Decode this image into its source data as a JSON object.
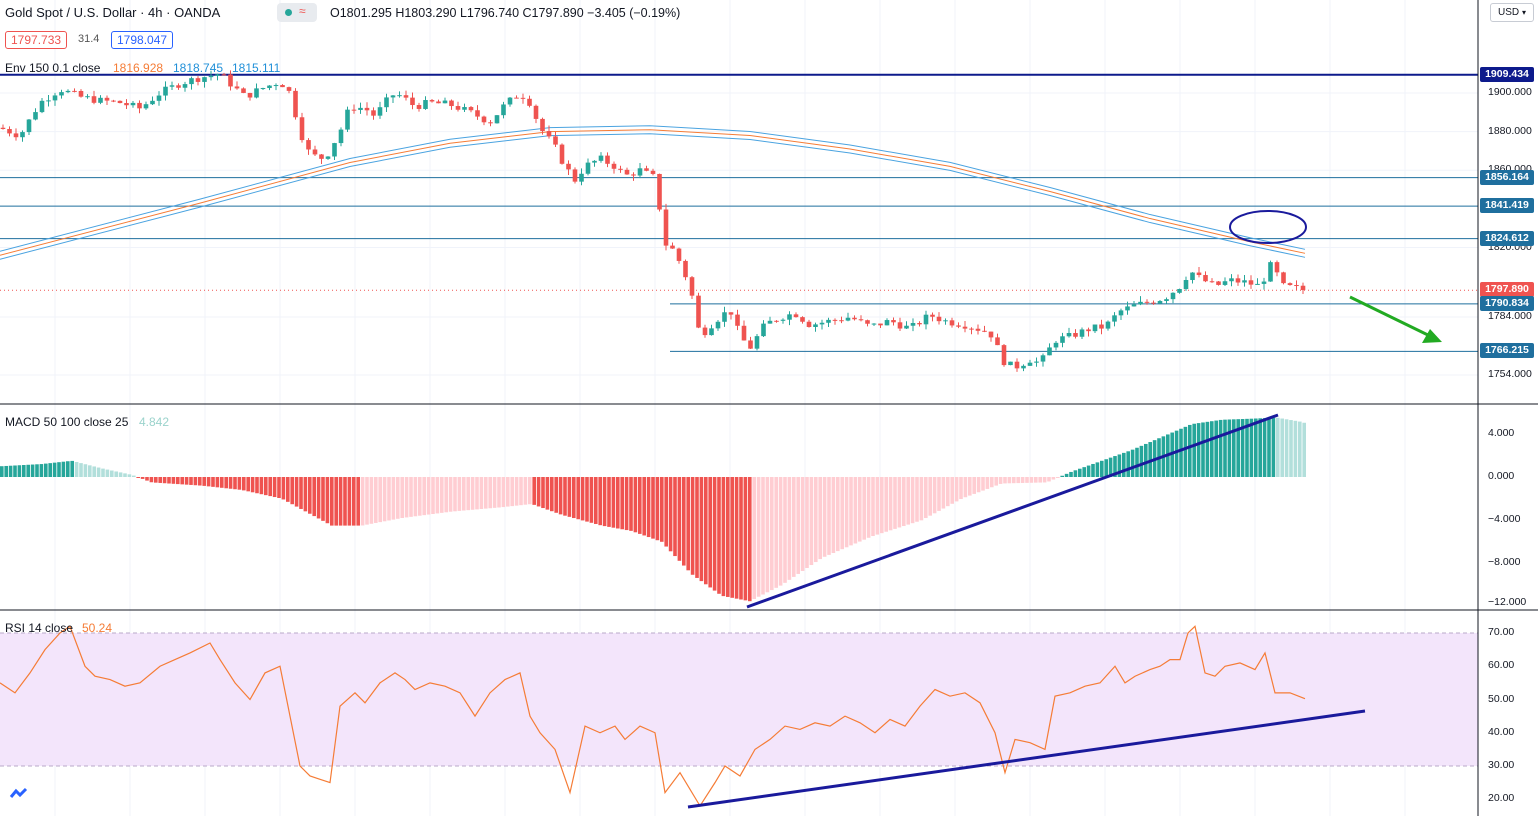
{
  "header": {
    "symbol": "Gold Spot / U.S. Dollar · 4h · OANDA",
    "ohlc": "O1801.295 H1803.290 L1796.740 C1797.890 −3.405 (−0.19%)",
    "sell_price": "1797.733",
    "spread": "31.4",
    "buy_price": "1798.047",
    "currency_button": "USD"
  },
  "indicators": {
    "env": {
      "label": "Env 150 0.1 close",
      "v1": "1816.928",
      "v2": "1818.745",
      "v3": "1815.111"
    },
    "macd": {
      "label": "MACD 50 100 close 25",
      "value": "4.842"
    },
    "rsi": {
      "label": "RSI 14 close",
      "value": "50.24"
    }
  },
  "price_axis": {
    "ticks": [
      "1900.000",
      "1880.000",
      "1860.000",
      "1820.000",
      "1784.000",
      "1754.000"
    ],
    "labels": [
      {
        "text": "1909.434",
        "color": "#0d1a8c"
      },
      {
        "text": "1856.164",
        "color": "#1f6f9e"
      },
      {
        "text": "1841.419",
        "color": "#1f6f9e"
      },
      {
        "text": "1824.612",
        "color": "#1f6f9e"
      },
      {
        "text": "1797.890",
        "color": "#ef5350"
      },
      {
        "text": "1790.834",
        "color": "#1f6f9e"
      },
      {
        "text": "1766.215",
        "color": "#1f6f9e"
      }
    ]
  },
  "macd_axis": {
    "ticks": [
      "4.000",
      "0.000",
      "−4.000",
      "−8.000",
      "−12.000"
    ]
  },
  "rsi_axis": {
    "ticks": [
      "70.00",
      "60.00",
      "50.00",
      "40.00",
      "30.00",
      "20.00"
    ]
  },
  "colors": {
    "bull": "#26a69a",
    "bear": "#ef5350",
    "hist_pos_strong": "#26a69a",
    "hist_pos_weak": "#b2dfdb",
    "hist_neg_strong": "#ef5350",
    "hist_neg_weak": "#ffcdd2",
    "rsi_line": "#f57c36",
    "rsi_band": "#f3e5fb",
    "support_line": "#1f6f9e",
    "top_line": "#0d1a8c",
    "trend_line": "#1a1a9c",
    "arrow": "#22aa22"
  },
  "chart_data": {
    "type": "candlestick",
    "timeframe": "4h",
    "levels": [
      1909.434,
      1856.164,
      1841.419,
      1824.612,
      1790.834,
      1766.215
    ],
    "last_price": 1797.89,
    "ohlc_last": {
      "open": 1801.295,
      "high": 1803.29,
      "low": 1796.74,
      "close": 1797.89
    },
    "close_path": [
      [
        0,
        1882
      ],
      [
        20,
        1878
      ],
      [
        40,
        1895
      ],
      [
        60,
        1902
      ],
      [
        80,
        1898
      ],
      [
        100,
        1896
      ],
      [
        120,
        1895
      ],
      [
        140,
        1892
      ],
      [
        160,
        1900
      ],
      [
        180,
        1905
      ],
      [
        200,
        1908
      ],
      [
        220,
        1910
      ],
      [
        230,
        1905
      ],
      [
        245,
        1898
      ],
      [
        260,
        1902
      ],
      [
        280,
        1906
      ],
      [
        290,
        1900
      ],
      [
        300,
        1880
      ],
      [
        310,
        1868
      ],
      [
        325,
        1866
      ],
      [
        340,
        1880
      ],
      [
        350,
        1893
      ],
      [
        365,
        1892
      ],
      [
        375,
        1888
      ],
      [
        385,
        1895
      ],
      [
        395,
        1900
      ],
      [
        405,
        1897
      ],
      [
        415,
        1893
      ],
      [
        430,
        1895
      ],
      [
        450,
        1894
      ],
      [
        470,
        1890
      ],
      [
        490,
        1885
      ],
      [
        505,
        1894
      ],
      [
        520,
        1900
      ],
      [
        530,
        1895
      ],
      [
        540,
        1882
      ],
      [
        555,
        1872
      ],
      [
        565,
        1862
      ],
      [
        575,
        1855
      ],
      [
        585,
        1862
      ],
      [
        600,
        1866
      ],
      [
        615,
        1862
      ],
      [
        625,
        1857
      ],
      [
        640,
        1860
      ],
      [
        655,
        1856
      ],
      [
        665,
        1822
      ],
      [
        675,
        1818
      ],
      [
        690,
        1800
      ],
      [
        700,
        1774
      ],
      [
        715,
        1782
      ],
      [
        730,
        1788
      ],
      [
        740,
        1774
      ],
      [
        750,
        1768
      ],
      [
        765,
        1780
      ],
      [
        780,
        1784
      ],
      [
        795,
        1786
      ],
      [
        810,
        1780
      ],
      [
        830,
        1782
      ],
      [
        850,
        1784
      ],
      [
        870,
        1779
      ],
      [
        890,
        1782
      ],
      [
        910,
        1778
      ],
      [
        930,
        1785
      ],
      [
        945,
        1782
      ],
      [
        965,
        1780
      ],
      [
        990,
        1776
      ],
      [
        1005,
        1760
      ],
      [
        1015,
        1758
      ],
      [
        1030,
        1762
      ],
      [
        1040,
        1760
      ],
      [
        1055,
        1772
      ],
      [
        1070,
        1774
      ],
      [
        1090,
        1778
      ],
      [
        1105,
        1779
      ],
      [
        1120,
        1787
      ],
      [
        1135,
        1790
      ],
      [
        1150,
        1792
      ],
      [
        1165,
        1794
      ],
      [
        1180,
        1800
      ],
      [
        1190,
        1808
      ],
      [
        1200,
        1804
      ],
      [
        1215,
        1800
      ],
      [
        1230,
        1803
      ],
      [
        1245,
        1802
      ],
      [
        1260,
        1800
      ],
      [
        1272,
        1812
      ],
      [
        1282,
        1800
      ],
      [
        1295,
        1799
      ],
      [
        1305,
        1797.89
      ]
    ],
    "envelope": [
      [
        0,
        1816
      ],
      [
        200,
        1843
      ],
      [
        350,
        1864
      ],
      [
        450,
        1874
      ],
      [
        550,
        1880
      ],
      [
        650,
        1881
      ],
      [
        750,
        1878
      ],
      [
        850,
        1871
      ],
      [
        950,
        1862
      ],
      [
        1050,
        1849
      ],
      [
        1150,
        1835
      ],
      [
        1250,
        1823
      ],
      [
        1305,
        1817
      ]
    ],
    "macd_hist": [
      [
        0,
        1.0
      ],
      [
        40,
        1.2
      ],
      [
        70,
        1.5
      ],
      [
        100,
        0.8
      ],
      [
        130,
        0.2
      ],
      [
        150,
        -0.5
      ],
      [
        200,
        -0.8
      ],
      [
        240,
        -1.2
      ],
      [
        280,
        -2.0
      ],
      [
        310,
        -3.5
      ],
      [
        330,
        -4.5
      ],
      [
        360,
        -4.5
      ],
      [
        400,
        -3.8
      ],
      [
        450,
        -3.2
      ],
      [
        500,
        -2.8
      ],
      [
        530,
        -2.5
      ],
      [
        560,
        -3.5
      ],
      [
        600,
        -4.5
      ],
      [
        630,
        -5.0
      ],
      [
        660,
        -6.0
      ],
      [
        690,
        -9.0
      ],
      [
        720,
        -11.0
      ],
      [
        748,
        -11.5
      ],
      [
        780,
        -10.0
      ],
      [
        820,
        -7.5
      ],
      [
        870,
        -5.5
      ],
      [
        920,
        -4.0
      ],
      [
        960,
        -2.0
      ],
      [
        1000,
        -0.6
      ],
      [
        1045,
        -0.5
      ],
      [
        1070,
        0.5
      ],
      [
        1100,
        1.5
      ],
      [
        1130,
        2.5
      ],
      [
        1160,
        3.7
      ],
      [
        1190,
        4.9
      ],
      [
        1220,
        5.3
      ],
      [
        1250,
        5.4
      ],
      [
        1275,
        5.5
      ],
      [
        1300,
        5.1
      ],
      [
        1308,
        4.842
      ]
    ],
    "rsi": [
      [
        0,
        55
      ],
      [
        15,
        52
      ],
      [
        30,
        58
      ],
      [
        45,
        65
      ],
      [
        60,
        70
      ],
      [
        70,
        72
      ],
      [
        85,
        60
      ],
      [
        95,
        57
      ],
      [
        110,
        56
      ],
      [
        125,
        54
      ],
      [
        140,
        55
      ],
      [
        160,
        60
      ],
      [
        175,
        62
      ],
      [
        190,
        64
      ],
      [
        210,
        67
      ],
      [
        220,
        62
      ],
      [
        235,
        55
      ],
      [
        250,
        50
      ],
      [
        265,
        58
      ],
      [
        280,
        60
      ],
      [
        290,
        45
      ],
      [
        300,
        30
      ],
      [
        310,
        27
      ],
      [
        320,
        26
      ],
      [
        330,
        25
      ],
      [
        340,
        48
      ],
      [
        355,
        52
      ],
      [
        365,
        49
      ],
      [
        380,
        55
      ],
      [
        395,
        58
      ],
      [
        405,
        56
      ],
      [
        415,
        53
      ],
      [
        430,
        55
      ],
      [
        445,
        54
      ],
      [
        460,
        52
      ],
      [
        475,
        45
      ],
      [
        490,
        52
      ],
      [
        505,
        56
      ],
      [
        520,
        58
      ],
      [
        530,
        45
      ],
      [
        540,
        40
      ],
      [
        555,
        35
      ],
      [
        570,
        22
      ],
      [
        585,
        42
      ],
      [
        600,
        40
      ],
      [
        615,
        42
      ],
      [
        625,
        38
      ],
      [
        640,
        42
      ],
      [
        655,
        40
      ],
      [
        665,
        22
      ],
      [
        680,
        28
      ],
      [
        700,
        18
      ],
      [
        715,
        25
      ],
      [
        725,
        30
      ],
      [
        740,
        27
      ],
      [
        755,
        35
      ],
      [
        770,
        38
      ],
      [
        785,
        42
      ],
      [
        800,
        41
      ],
      [
        815,
        43
      ],
      [
        830,
        42
      ],
      [
        845,
        45
      ],
      [
        860,
        43
      ],
      [
        875,
        40
      ],
      [
        890,
        44
      ],
      [
        905,
        42
      ],
      [
        920,
        48
      ],
      [
        935,
        53
      ],
      [
        950,
        51
      ],
      [
        965,
        52
      ],
      [
        980,
        49
      ],
      [
        995,
        40
      ],
      [
        1005,
        28
      ],
      [
        1015,
        38
      ],
      [
        1030,
        37
      ],
      [
        1045,
        35
      ],
      [
        1055,
        51
      ],
      [
        1070,
        52
      ],
      [
        1085,
        54
      ],
      [
        1100,
        55
      ],
      [
        1115,
        60
      ],
      [
        1125,
        55
      ],
      [
        1135,
        57
      ],
      [
        1150,
        59
      ],
      [
        1160,
        60
      ],
      [
        1170,
        62
      ],
      [
        1180,
        62
      ],
      [
        1188,
        70
      ],
      [
        1195,
        72
      ],
      [
        1205,
        58
      ],
      [
        1215,
        57
      ],
      [
        1225,
        60
      ],
      [
        1240,
        61
      ],
      [
        1255,
        59
      ],
      [
        1265,
        64
      ],
      [
        1275,
        52
      ],
      [
        1290,
        52
      ],
      [
        1305,
        50.24
      ]
    ],
    "rsi_band": [
      30,
      70
    ],
    "annotations": [
      "support/resistance lines",
      "ellipse at envelope touch",
      "green down arrow",
      "MACD rising trendline",
      "RSI rising trendline"
    ]
  }
}
